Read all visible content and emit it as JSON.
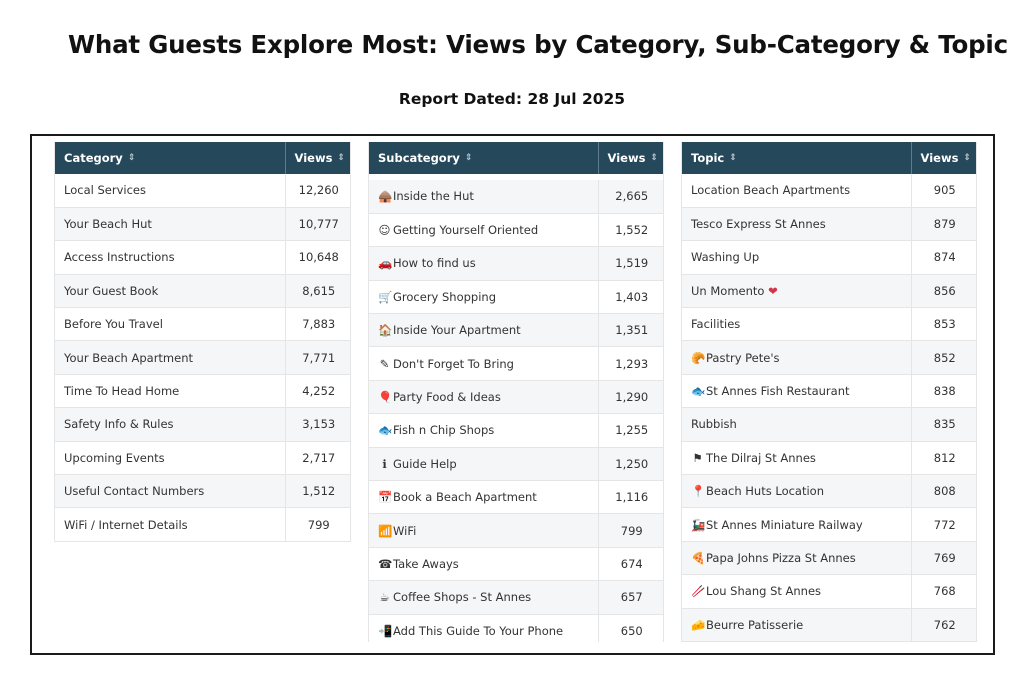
{
  "title": "What Guests Explore Most: Views by Category, Sub-Category & Topic",
  "report_date": "Report Dated: 28 Jul 2025",
  "sort_icon": "⇕",
  "tables": {
    "category": {
      "headers": [
        "Category",
        "Views"
      ],
      "rows": [
        {
          "label": "Local Services",
          "views": "12,260"
        },
        {
          "label": "Your Beach Hut",
          "views": "10,777"
        },
        {
          "label": "Access Instructions",
          "views": "10,648"
        },
        {
          "label": "Your Guest Book",
          "views": "8,615"
        },
        {
          "label": "Before You Travel",
          "views": "7,883"
        },
        {
          "label": "Your Beach Apartment",
          "views": "7,771"
        },
        {
          "label": "Time To Head Home",
          "views": "4,252"
        },
        {
          "label": "Safety Info & Rules",
          "views": "3,153"
        },
        {
          "label": "Upcoming Events",
          "views": "2,717"
        },
        {
          "label": "Useful Contact Numbers",
          "views": "1,512"
        },
        {
          "label": "WiFi / Internet Details",
          "views": "799"
        }
      ]
    },
    "subcategory": {
      "headers": [
        "Subcategory",
        "Views"
      ],
      "rows": [
        {
          "emoji": "🛖",
          "label": "Inside the Hut",
          "views": "2,665"
        },
        {
          "emoji": "☺",
          "label": "Getting Yourself Oriented",
          "views": "1,552"
        },
        {
          "emoji": "🚗",
          "label": "How to find us",
          "views": "1,519"
        },
        {
          "emoji": "🛒",
          "label": "Grocery Shopping",
          "views": "1,403"
        },
        {
          "emoji": "🏠",
          "label": "Inside Your Apartment",
          "views": "1,351"
        },
        {
          "emoji": "✎",
          "label": "Don't Forget To Bring",
          "views": "1,293"
        },
        {
          "emoji": "🎈",
          "label": "Party Food & Ideas",
          "views": "1,290"
        },
        {
          "emoji": "🐟",
          "label": "Fish n Chip Shops",
          "views": "1,255"
        },
        {
          "emoji": "ℹ",
          "label": "Guide Help",
          "views": "1,250"
        },
        {
          "emoji": "📅",
          "label": "Book a Beach Apartment",
          "views": "1,116"
        },
        {
          "emoji": "📶",
          "label": "WiFi",
          "views": "799"
        },
        {
          "emoji": "☎",
          "label": "Take Aways",
          "views": "674"
        },
        {
          "emoji": "☕",
          "label": "Coffee Shops - St Annes",
          "views": "657"
        },
        {
          "emoji": "📲",
          "label": "Add This Guide To Your Phone",
          "views": "650"
        }
      ]
    },
    "topic": {
      "headers": [
        "Topic",
        "Views"
      ],
      "rows": [
        {
          "emoji": "",
          "label": "Location Beach Apartments",
          "views": "905"
        },
        {
          "emoji": "",
          "label": "Tesco Express St Annes",
          "views": "879"
        },
        {
          "emoji": "",
          "label": "Washing Up",
          "views": "874"
        },
        {
          "emoji": "",
          "label": "Un Momento",
          "suffix": "❤",
          "views": "856"
        },
        {
          "emoji": "",
          "label": "Facilities",
          "views": "853"
        },
        {
          "emoji": "🥐",
          "label": "Pastry Pete's",
          "views": "852"
        },
        {
          "emoji": "🐟",
          "label": "St Annes Fish Restaurant",
          "views": "838"
        },
        {
          "emoji": "",
          "label": "Rubbish",
          "views": "835"
        },
        {
          "emoji": "⚑",
          "label": "The Dilraj St Annes",
          "views": "812"
        },
        {
          "emoji": "📍",
          "label": "Beach Huts Location",
          "views": "808"
        },
        {
          "emoji": "🚂",
          "label": "St Annes Miniature Railway",
          "views": "772"
        },
        {
          "emoji": "🍕",
          "label": "Papa Johns Pizza St Annes",
          "views": "769"
        },
        {
          "emoji": "🥢",
          "label": "Lou Shang St Annes",
          "views": "768"
        },
        {
          "emoji": "🧀",
          "label": "Beurre Patisserie",
          "views": "762"
        }
      ]
    }
  }
}
